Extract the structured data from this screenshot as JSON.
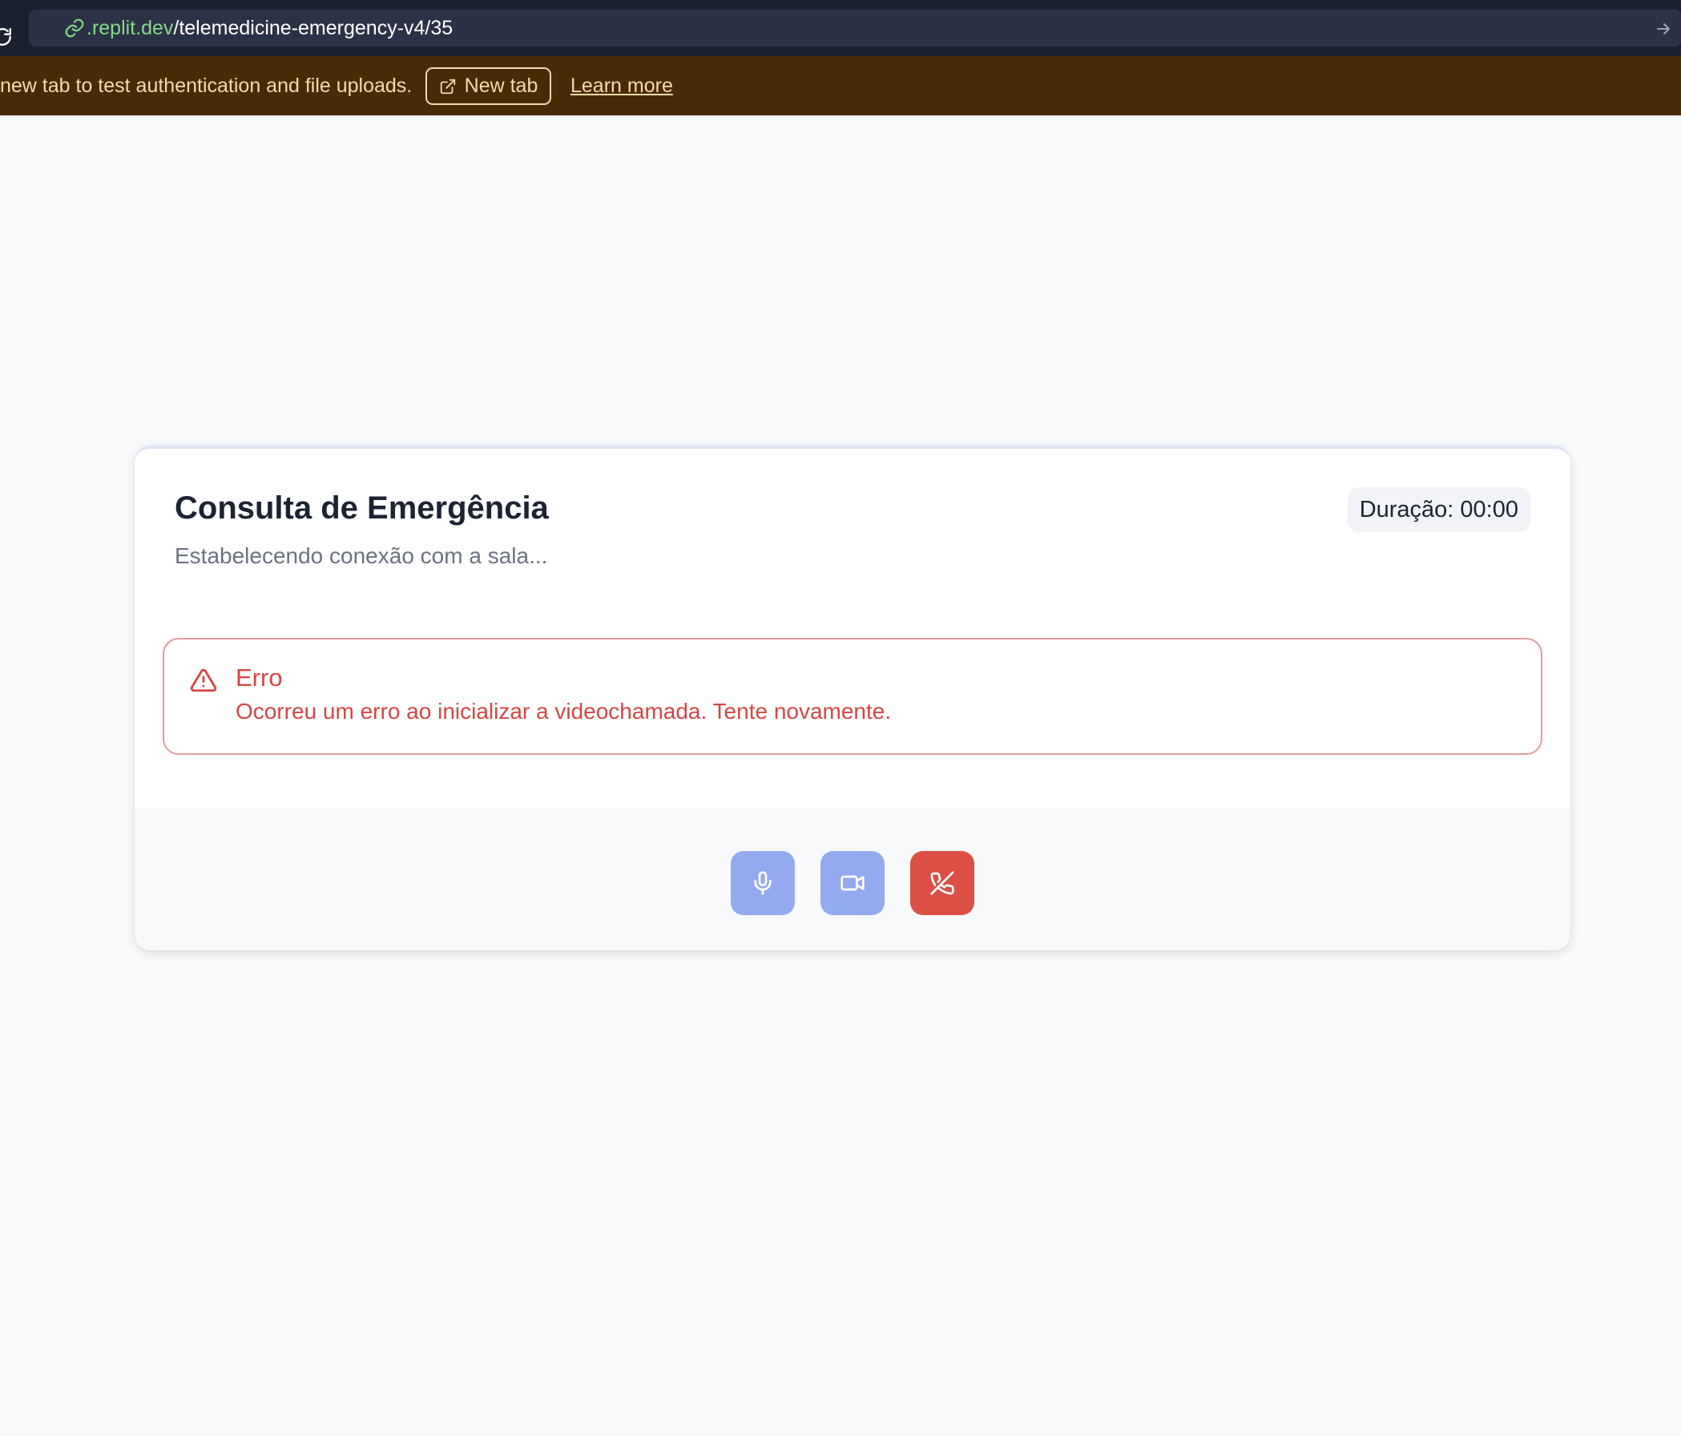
{
  "browser": {
    "url_host": ".replit.dev",
    "url_path": "/telemedicine-emergency-v4/35"
  },
  "banner": {
    "message": "new tab to test authentication and file uploads.",
    "new_tab_label": "New tab",
    "learn_more_label": "Learn more"
  },
  "call": {
    "title": "Consulta de Emergência",
    "subtitle": "Estabelecendo conexão com a sala...",
    "duration": "Duração: 00:00"
  },
  "error": {
    "title": "Erro",
    "message": "Ocorreu um erro ao inicializar a videochamada. Tente novamente."
  },
  "controls": {
    "mic_icon": "microphone-icon",
    "camera_icon": "video-camera-icon",
    "end_icon": "phone-off-icon"
  },
  "colors": {
    "banner_bg": "#4a2a06",
    "banner_text": "#f6d9a9",
    "url_host": "#86d986",
    "error": "#d74545",
    "control_primary": "#93aaf0",
    "control_danger": "#dc4f44"
  }
}
